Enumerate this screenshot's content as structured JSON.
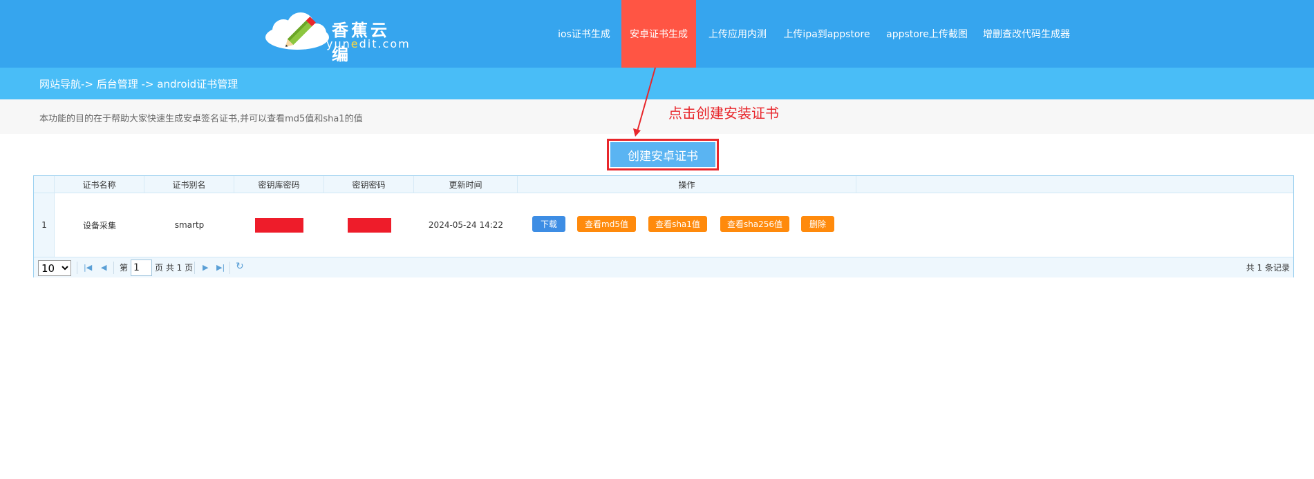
{
  "header": {
    "logo": {
      "title": "香蕉云编",
      "subtitle_pre": "yun",
      "subtitle_mark": "e",
      "subtitle_post": "dit.com"
    },
    "nav": [
      {
        "label": "ios证书生成",
        "active": false
      },
      {
        "label": "安卓证书生成",
        "active": true
      },
      {
        "label": "上传应用内测",
        "active": false
      },
      {
        "label": "上传ipa到appstore",
        "active": false
      },
      {
        "label": "appstore上传截图",
        "active": false
      },
      {
        "label": "增删查改代码生成器",
        "active": false
      }
    ]
  },
  "breadcrumb": "网站导航-> 后台管理 -> android证书管理",
  "description": "本功能的目的在于帮助大家快速生成安卓签名证书,并可以查看md5值和sha1的值",
  "annotation": "点击创建安装证书",
  "create_button": "创建安卓证书",
  "table": {
    "columns": [
      "证书名称",
      "证书别名",
      "密钥库密码",
      "密钥密码",
      "更新时间",
      "操作"
    ],
    "rows": [
      {
        "index": "1",
        "name": "设备采集",
        "alias": "smartp",
        "store_password": "",
        "key_password": "",
        "updated": "2024-05-24 14:22"
      }
    ],
    "actions": [
      {
        "label": "下载",
        "color": "#3d8de4"
      },
      {
        "label": "查看md5值",
        "color": "#ff8a0c"
      },
      {
        "label": "查看sha1值",
        "color": "#ff8a0c"
      },
      {
        "label": "查看sha256值",
        "color": "#ff8a0c"
      },
      {
        "label": "删除",
        "color": "#ff8a0c"
      }
    ]
  },
  "pager": {
    "page_size": "10",
    "page_size_options": [
      "10"
    ],
    "page_prefix": "第",
    "current_page": "1",
    "page_suffix": "页 共 1 页",
    "total": "共 1 条记录"
  },
  "colors": {
    "header": "#36a5ee",
    "nav_active": "#ff5544",
    "breadcrumb": "#49bdf7",
    "annotation": "#e8262b",
    "mask": "#ee1c2a"
  }
}
